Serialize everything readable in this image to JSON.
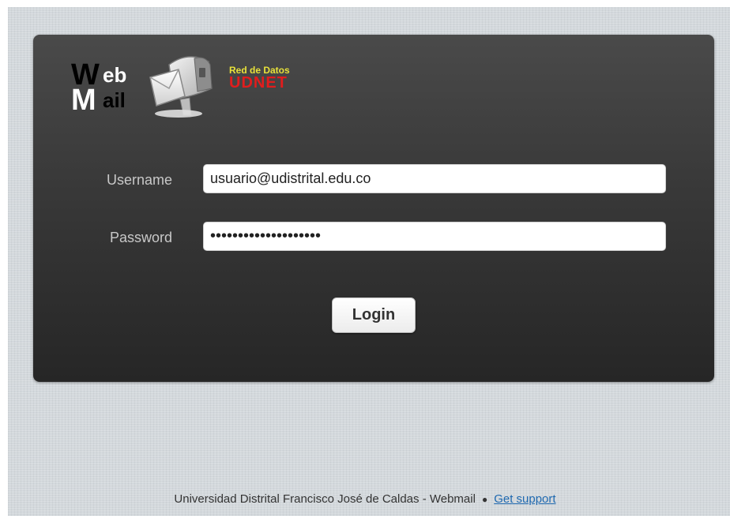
{
  "logo": {
    "webmail": {
      "w": "W",
      "eb": "eb",
      "m": "M",
      "ail": "ail"
    },
    "udnet_top": "Red de Datos",
    "udnet_bottom": "UDNET"
  },
  "form": {
    "username_label": "Username",
    "username_value": "usuario@udistrital.edu.co",
    "password_label": "Password",
    "password_value": "••••••••••••••••••••",
    "login_label": "Login"
  },
  "footer": {
    "text": "Universidad Distrital Francisco José de Caldas - Webmail",
    "separator": "●",
    "support_link": "Get support"
  },
  "colors": {
    "panel": "#333333",
    "udnet_yellow": "#e8e23a",
    "udnet_red": "#e11d1d",
    "link": "#1f69b0"
  }
}
